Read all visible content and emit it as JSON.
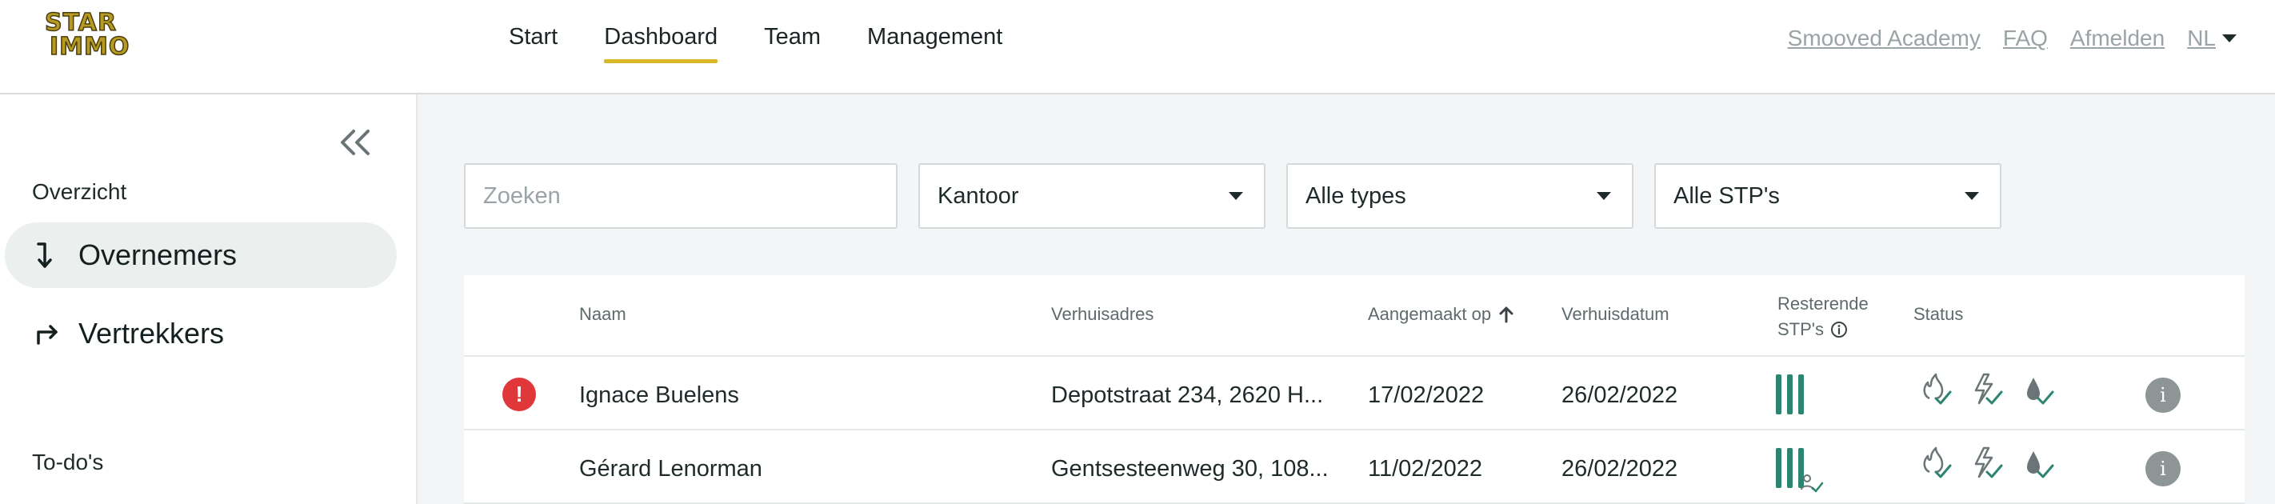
{
  "logo": {
    "line1": "STAR",
    "line2": "IMMO"
  },
  "nav": {
    "items": [
      {
        "label": "Start"
      },
      {
        "label": "Dashboard"
      },
      {
        "label": "Team"
      },
      {
        "label": "Management"
      }
    ],
    "active": "Dashboard"
  },
  "toplinks": {
    "academy": "Smooved Academy",
    "faq": "FAQ",
    "logout": "Afmelden",
    "lang": "NL"
  },
  "sidebar": {
    "overview_title": "Overzicht",
    "items": [
      {
        "label": "Overnemers",
        "icon": "arrow-down-right-icon",
        "active": true
      },
      {
        "label": "Vertrekkers",
        "icon": "arrow-up-right-icon",
        "active": false
      }
    ],
    "todo_title": "To-do's"
  },
  "filters": {
    "search_placeholder": "Zoeken",
    "office": "Kantoor",
    "types": "Alle types",
    "stps": "Alle STP's"
  },
  "table": {
    "headers": {
      "name": "Naam",
      "address": "Verhuisadres",
      "created": "Aangemaakt op",
      "move_date": "Verhuisdatum",
      "remaining_line1": "Resterende",
      "remaining_line2": "STP's",
      "status": "Status"
    },
    "rows": [
      {
        "alert": true,
        "name": "Ignace Buelens",
        "address": "Depotstraat 234, 2620 H...",
        "created": "17/02/2022",
        "move_date": "26/02/2022",
        "remaining_stps": 3,
        "status": [
          "gas-check-icon",
          "electricity-check-icon",
          "water-check-icon"
        ]
      },
      {
        "alert": false,
        "name": "Gérard Lenorman",
        "address": "Gentsesteenweg 30, 108...",
        "created": "11/02/2022",
        "move_date": "26/02/2022",
        "remaining_stps": 3,
        "status": [
          "gas-check-icon",
          "electricity-check-icon",
          "water-check-icon"
        ]
      }
    ]
  },
  "colors": {
    "accent": "#d8b728",
    "brand_green": "#2c8471",
    "alert_red": "#e0373b",
    "info_grey": "#8e9596"
  }
}
